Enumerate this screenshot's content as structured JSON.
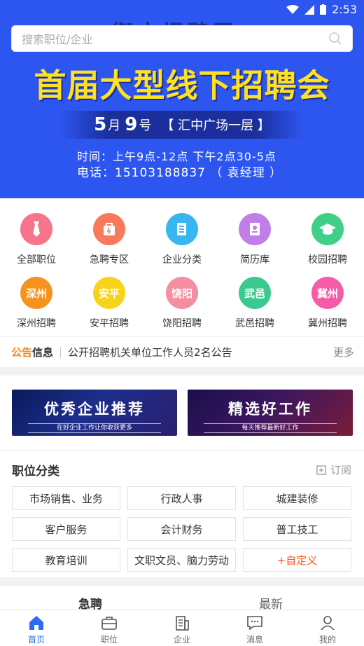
{
  "status_bar": {
    "time": "2:53"
  },
  "banner": {
    "bg_title": "衡水招聘网",
    "headline": "首届大型线下招聘会",
    "date_month_num": "5",
    "date_month": "月",
    "date_day_num": "9",
    "date_day": "号",
    "place": "【 汇中广场一层 】",
    "time_line": "时间：上午9点-12点  下午2点30-5点",
    "phone_line": "电话：15103188837 （ 袁经理 ）"
  },
  "search": {
    "placeholder": "搜索职位/企业"
  },
  "categories": [
    {
      "label": "全部职位",
      "icon": "tie-icon",
      "color": "#f7748a"
    },
    {
      "label": "急聘专区",
      "icon": "bag-icon",
      "color": "#f9795b"
    },
    {
      "label": "企业分类",
      "icon": "building-icon",
      "color": "#37b6f2"
    },
    {
      "label": "简历库",
      "icon": "resume-icon",
      "color": "#c27ee8"
    },
    {
      "label": "校园招聘",
      "icon": "graduation-cap-icon",
      "color": "#3fcf86"
    },
    {
      "label": "深州招聘",
      "icon": "深州",
      "color": "#f5931e"
    },
    {
      "label": "安平招聘",
      "icon": "安平",
      "color": "#f9d21c"
    },
    {
      "label": "饶阳招聘",
      "icon": "饶阳",
      "color": "#f48ea0"
    },
    {
      "label": "武邑招聘",
      "icon": "武邑",
      "color": "#3cc98f"
    },
    {
      "label": "冀州招聘",
      "icon": "冀州",
      "color": "#f55ca8"
    }
  ],
  "notice": {
    "tag_a": "公告",
    "tag_b": "信息",
    "text": "公开招聘机关单位工作人员2名公告",
    "more": "更多"
  },
  "promos": [
    {
      "title": "优秀企业推荐",
      "subtitle": "在好企业工作让你收获更多"
    },
    {
      "title": "精选好工作",
      "subtitle": "每天推荐最新好工作"
    }
  ],
  "jobs": {
    "title": "职位分类",
    "subscribe": "订阅",
    "tags": [
      "市场销售、业务",
      "行政人事",
      "城建装修",
      "客户服务",
      "会计财务",
      "普工技工",
      "教育培训",
      "文职文员、脑力劳动",
      "+自定义"
    ]
  },
  "tabs": [
    "急聘",
    "最新"
  ],
  "bottom_nav": [
    {
      "label": "首页",
      "icon": "home-icon"
    },
    {
      "label": "职位",
      "icon": "briefcase-icon"
    },
    {
      "label": "企业",
      "icon": "company-icon"
    },
    {
      "label": "消息",
      "icon": "message-icon"
    },
    {
      "label": "我的",
      "icon": "user-icon"
    }
  ],
  "colors": {
    "banner_blue": "#2d55f0",
    "headline_yellow": "#ffe21f",
    "accent_orange": "#f58a1f",
    "nav_active": "#2a6cf2"
  }
}
